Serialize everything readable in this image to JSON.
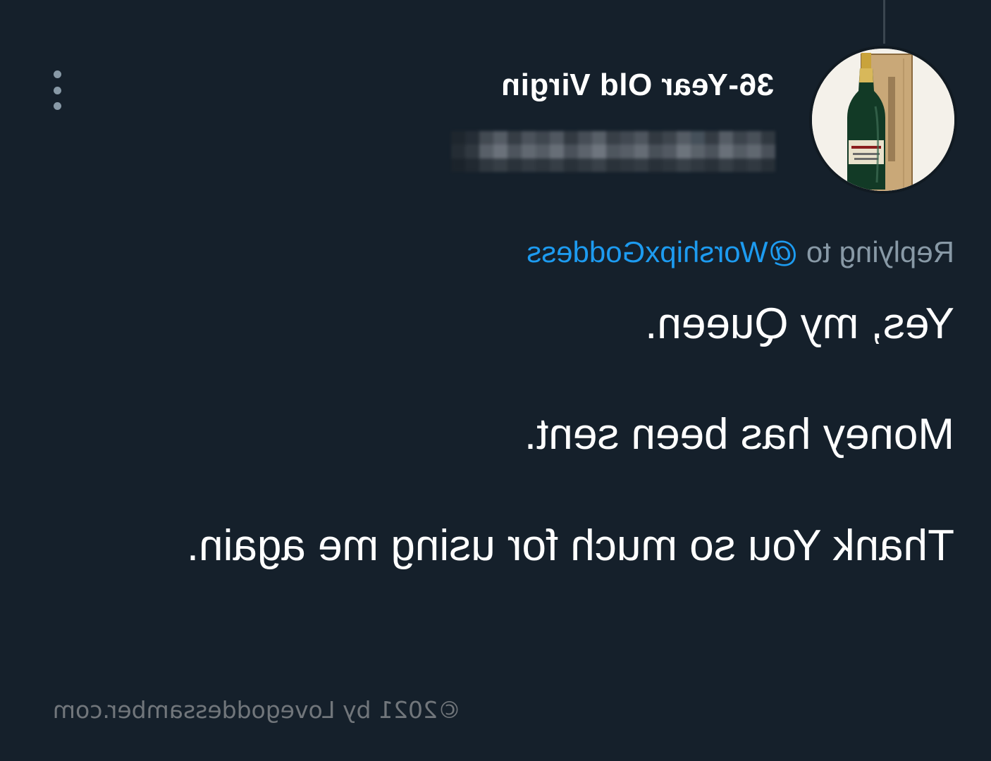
{
  "tweet": {
    "author": {
      "display_name": "36-Year Old Virgin",
      "handle_obscured": true,
      "avatar_icon": "champagne-bottle-icon"
    },
    "more_icon": "more-vertical-icon",
    "reply": {
      "prefix": "Replying to",
      "mention": "@WorshipxGoddess"
    },
    "body": [
      "Yes, my Queen.",
      "Money has been sent.",
      "Thank You so much for using me again."
    ]
  },
  "watermark": "©2021 by Lovegoddessamber.com",
  "colors": {
    "background": "#15202b",
    "text": "#ffffff",
    "muted": "#8899a6",
    "mention": "#1d9bf0"
  }
}
